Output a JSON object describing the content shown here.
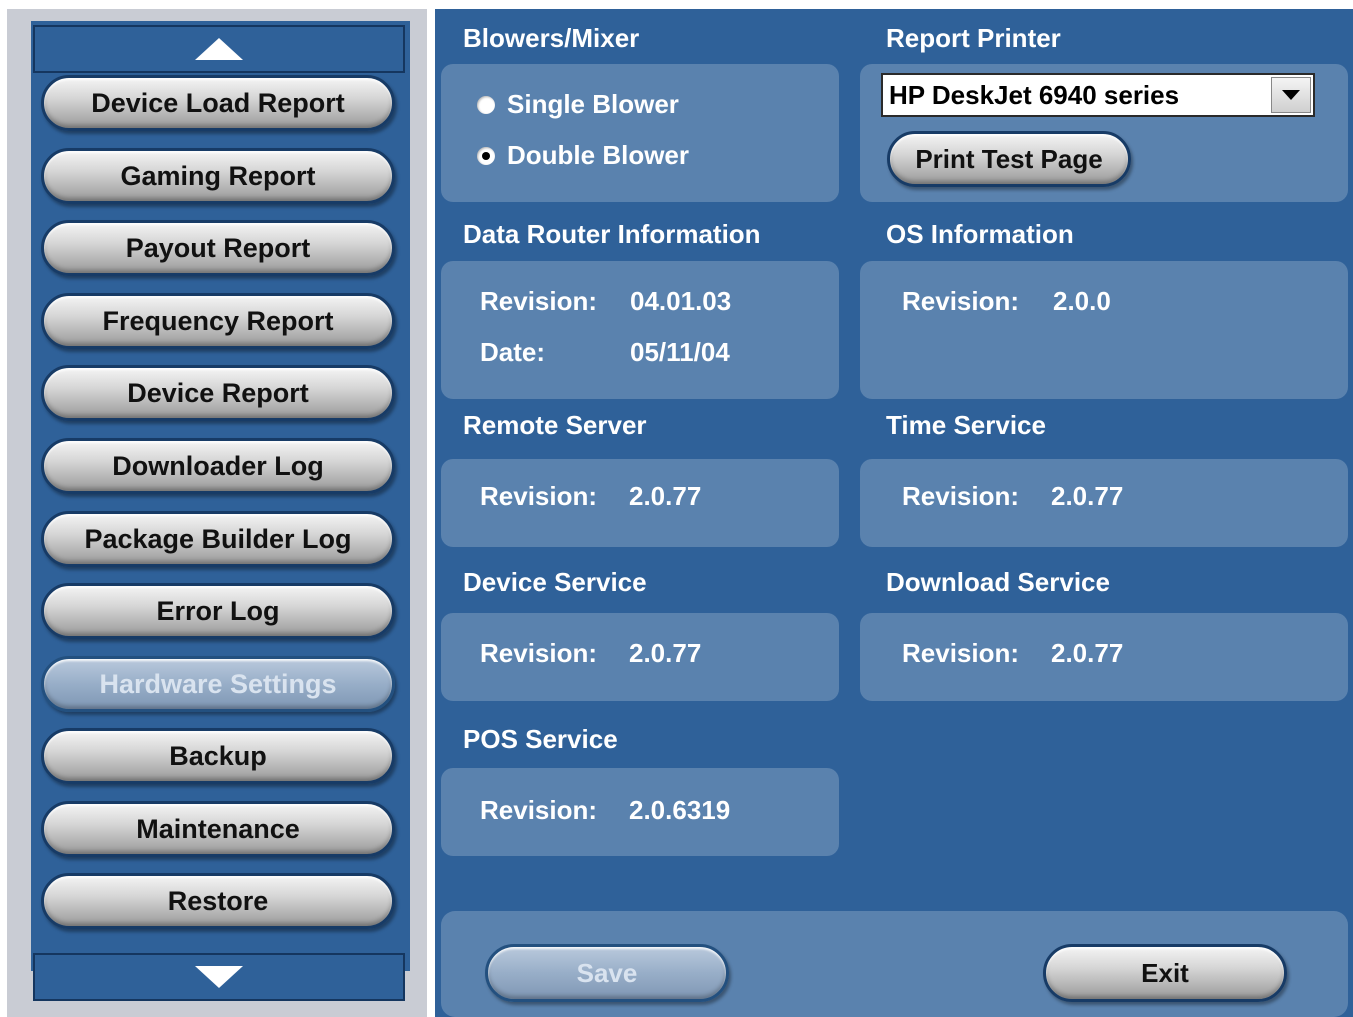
{
  "nav": {
    "items": [
      {
        "label": "Device Load Report",
        "enabled": true
      },
      {
        "label": "Gaming Report",
        "enabled": true
      },
      {
        "label": "Payout Report",
        "enabled": true
      },
      {
        "label": "Frequency Report",
        "enabled": true
      },
      {
        "label": "Device Report",
        "enabled": true
      },
      {
        "label": "Downloader Log",
        "enabled": true
      },
      {
        "label": "Package Builder Log",
        "enabled": true
      },
      {
        "label": "Error Log",
        "enabled": true
      },
      {
        "label": "Hardware Settings",
        "enabled": false
      },
      {
        "label": "Backup",
        "enabled": true
      },
      {
        "label": "Maintenance",
        "enabled": true
      },
      {
        "label": "Restore",
        "enabled": true
      }
    ],
    "scroll_up_icon": "triangle-up-icon",
    "scroll_down_icon": "triangle-down-icon"
  },
  "blowers": {
    "title": "Blowers/Mixer",
    "options": [
      {
        "label": "Single Blower",
        "selected": false
      },
      {
        "label": "Double Blower",
        "selected": true
      }
    ]
  },
  "report_printer": {
    "title": "Report Printer",
    "selected": "HP DeskJet 6940 series",
    "print_test_label": "Print Test Page"
  },
  "data_router": {
    "title": "Data Router Information",
    "revision_label": "Revision:",
    "revision": "04.01.03",
    "date_label": "Date:",
    "date": "05/11/04"
  },
  "os_info": {
    "title": "OS Information",
    "revision_label": "Revision:",
    "revision": "2.0.0"
  },
  "remote_server": {
    "title": "Remote Server",
    "revision_label": "Revision:",
    "revision": "2.0.77"
  },
  "time_service": {
    "title": "Time Service",
    "revision_label": "Revision:",
    "revision": "2.0.77"
  },
  "device_service": {
    "title": "Device Service",
    "revision_label": "Revision:",
    "revision": "2.0.77"
  },
  "download_service": {
    "title": "Download Service",
    "revision_label": "Revision:",
    "revision": "2.0.77"
  },
  "pos_service": {
    "title": "POS Service",
    "revision_label": "Revision:",
    "revision": "2.0.6319"
  },
  "footer": {
    "save_label": "Save",
    "save_enabled": false,
    "exit_label": "Exit"
  },
  "colors": {
    "panel_bg": "#2f6199",
    "box_bg": "#5a82ae",
    "nav_frame": "#c9ccd4"
  }
}
